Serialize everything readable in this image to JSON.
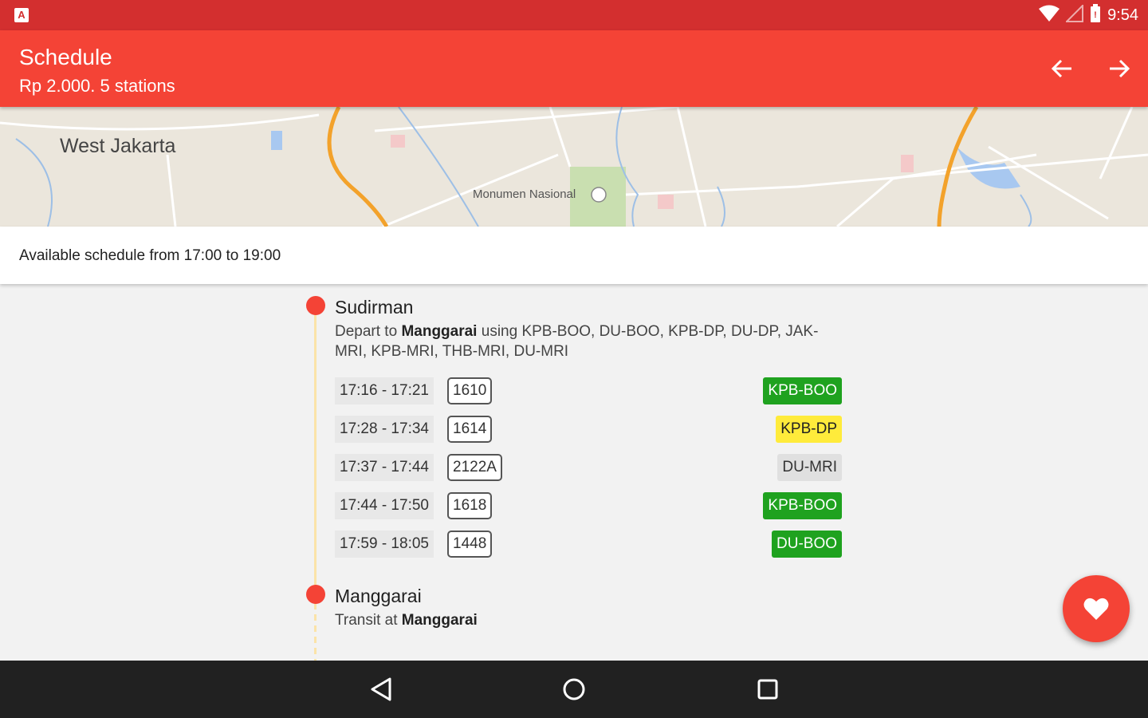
{
  "status_bar": {
    "time": "9:54",
    "icons": [
      "app-notification-icon",
      "wifi-icon",
      "signal-icon",
      "battery-icon"
    ]
  },
  "app_bar": {
    "title": "Schedule",
    "subtitle": "Rp 2.000. 5 stations",
    "actions": [
      "arrow-back-icon",
      "arrow-forward-icon"
    ]
  },
  "map": {
    "labels": {
      "city": "West Jakarta",
      "poi": "Monumen Nasional"
    }
  },
  "info": {
    "text": "Available schedule from 17:00 to 19:00"
  },
  "stations": [
    {
      "name": "Sudirman",
      "desc_prefix": "Depart to ",
      "desc_bold": "Manggarai",
      "desc_suffix": " using KPB-BOO, DU-BOO, KPB-DP, DU-DP, JAK-MRI, KPB-MRI, THB-MRI, DU-MRI"
    },
    {
      "name": "Manggarai",
      "desc_prefix": "Transit at ",
      "desc_bold": "Manggarai",
      "desc_suffix": ""
    }
  ],
  "trips": [
    {
      "time": "17:16 - 17:21",
      "train": "1610",
      "route": "KPB-BOO",
      "route_bg": "#1fa21f",
      "route_fg": "#ffffff"
    },
    {
      "time": "17:28 - 17:34",
      "train": "1614",
      "route": "KPB-DP",
      "route_bg": "#ffeb3b",
      "route_fg": "#222222"
    },
    {
      "time": "17:37 - 17:44",
      "train": "2122A",
      "route": "DU-MRI",
      "route_bg": "#e0e0e0",
      "route_fg": "#333333"
    },
    {
      "time": "17:44 - 17:50",
      "train": "1618",
      "route": "KPB-BOO",
      "route_bg": "#1fa21f",
      "route_fg": "#ffffff"
    },
    {
      "time": "17:59 - 18:05",
      "train": "1448",
      "route": "DU-BOO",
      "route_bg": "#1fa21f",
      "route_fg": "#ffffff"
    }
  ],
  "fab": {
    "icon": "heart-icon"
  },
  "nav_bar": {
    "buttons": [
      "back-icon",
      "home-icon",
      "recents-icon"
    ]
  },
  "colors": {
    "primary": "#f44336",
    "primary_dark": "#d32f2f",
    "timeline": "#fbe3a8"
  }
}
